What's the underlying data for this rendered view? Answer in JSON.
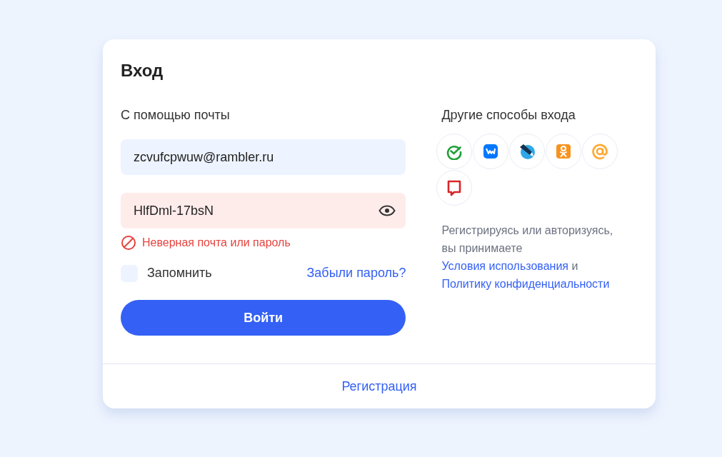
{
  "title": "Вход",
  "email_section": {
    "heading": "С помощью почты",
    "email": {
      "value": "zcvufcpwuw@rambler.ru",
      "error": false
    },
    "password": {
      "value": "HlfDml-17bsN",
      "error": true
    },
    "error_message": "Неверная почта или пароль",
    "remember": {
      "label": "Запомнить",
      "checked": false
    },
    "forgot_link": "Забыли пароль?",
    "submit": "Войти"
  },
  "other_section": {
    "heading": "Другие способы входа",
    "providers": [
      {
        "kind": "check"
      },
      {
        "kind": "vk"
      },
      {
        "kind": "pen"
      },
      {
        "kind": "ok"
      },
      {
        "kind": "at"
      },
      {
        "kind": "speech"
      }
    ],
    "terms": [
      {
        "kind": "text",
        "text": "Регистрируясь или авторизуясь, вы принимаете "
      },
      {
        "kind": "link",
        "text": "Условия использования"
      },
      {
        "kind": "text",
        "text": " и "
      },
      {
        "kind": "link",
        "text": "Политику конфиденциальности"
      }
    ]
  },
  "register_link": "Регистрация"
}
